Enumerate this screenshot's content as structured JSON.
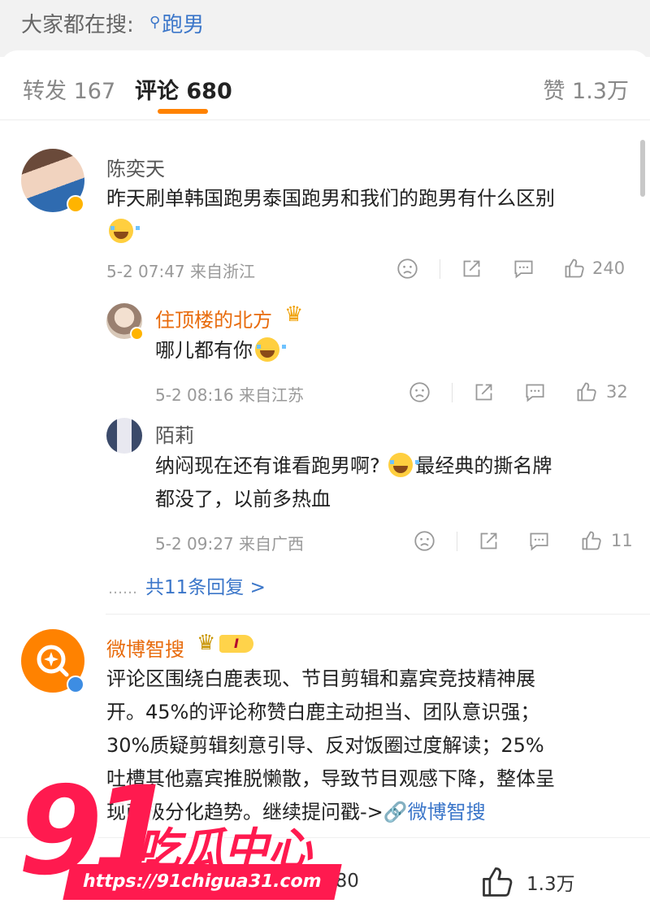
{
  "search": {
    "prefix": "大家都在搜:",
    "term": "跑男"
  },
  "tabs": {
    "repost": "转发 167",
    "comments": "评论 680",
    "likes": "赞 1.3万"
  },
  "comments": [
    {
      "author": "陈奕天",
      "text": "昨天刷单韩国跑男泰国跑男和我们的跑男有什么区别",
      "time": "5-2 07:47",
      "location": "来自浙江",
      "likes": "240",
      "replies": [
        {
          "author": "住顶楼的北方",
          "text": "哪儿都有你",
          "time": "5-2 08:16",
          "location": "来自江苏",
          "likes": "32"
        },
        {
          "author": "陌莉",
          "text_a": "纳闷现在还有谁看跑男啊?",
          "text_b": "最经典的撕名牌",
          "text_c": "都没了，以前多热血",
          "time": "5-2 09:27",
          "location": "来自广西",
          "likes": "11"
        }
      ],
      "more_replies": "共11条回复 >",
      "more_dots": "……"
    },
    {
      "author": "微博智搜",
      "level_badge": "I",
      "lines": [
        "评论区围绕白鹿表现、节目剪辑和嘉宾竞技精神展",
        "开。45%的评论称赞白鹿主动担当、团队意识强；",
        "30%质疑剪辑刻意引导、反对饭圈过度解读；25%",
        "吐槽其他嘉宾推脱懒散，导致节目观感下降，整体呈",
        "现两极分化趋势。继续提问戳->"
      ],
      "link_text": "微博智搜"
    }
  ],
  "bottom_bar": {
    "comments": "680",
    "likes": "1.3万"
  },
  "watermark": {
    "number": "91",
    "brand": "吃瓜中心",
    "url": "https://91chigua31.com"
  },
  "colors": {
    "accent": "#ff8200",
    "link": "#3b76c9",
    "vip_name": "#e86b0c",
    "watermark": "#ff1a4f"
  }
}
